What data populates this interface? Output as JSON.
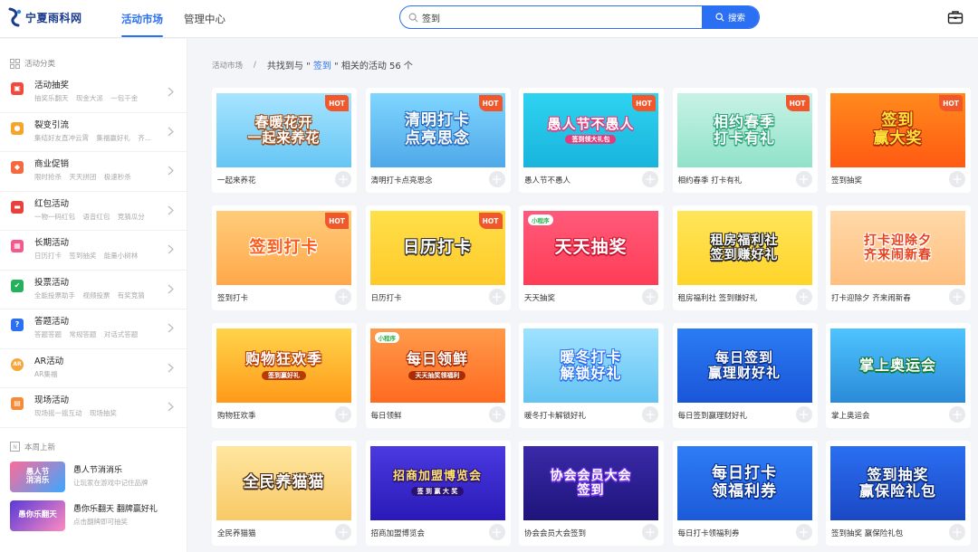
{
  "header": {
    "logo_text": "宁夏雨科网",
    "nav": [
      {
        "label": "活动市场",
        "active": true
      },
      {
        "label": "管理中心",
        "active": false
      }
    ],
    "search": {
      "value": "签到",
      "button": "搜索"
    }
  },
  "sidebar": {
    "section_title": "活动分类",
    "categories": [
      {
        "title": "活动抽奖",
        "sub": "抽奖乐翻天 现金大派 一包千金",
        "icon": "gift-icon",
        "color": "#f0493e"
      },
      {
        "title": "裂变引流",
        "sub": "集结好友直冲云霄 集福赢好礼 齐...",
        "icon": "user-icon",
        "color": "#f7a52a"
      },
      {
        "title": "商业促销",
        "sub": "限时抢杀 天天拼团 极速秒杀",
        "icon": "tag-icon",
        "color": "#f4693d"
      },
      {
        "title": "红包活动",
        "sub": "一物一码红包 语音红包 竞猜瓜分",
        "icon": "red-envelope-icon",
        "color": "#e8403a"
      },
      {
        "title": "长期活动",
        "sub": "日历打卡 签到抽奖 能量小树林",
        "icon": "calendar-icon",
        "color": "#f25a8f"
      },
      {
        "title": "投票活动",
        "sub": "全能投票助手 视频投票 有奖竞猜",
        "icon": "vote-icon",
        "color": "#23b15c"
      },
      {
        "title": "答题活动",
        "sub": "答题答题 常规答题 对话式答题",
        "icon": "question-icon",
        "color": "#2b6ff2"
      },
      {
        "title": "AR活动",
        "sub": "AR集福",
        "icon": "ar-icon",
        "color": "#f6a63a"
      },
      {
        "title": "现场活动",
        "sub": "现场摇一摇互动 现场抽奖",
        "icon": "live-icon",
        "color": "#f58a37"
      }
    ],
    "new_title": "本周上新",
    "new_items": [
      {
        "title": "愚人节消消乐",
        "sub": "让玩家在游戏中记住品牌",
        "thumb": "愚人节\n消消乐"
      },
      {
        "title": "愚你乐翻天 翻牌赢好礼",
        "sub": "点击翻牌即可抽奖",
        "thumb": "愚你乐翻天"
      }
    ]
  },
  "breadcrumb": {
    "root": "活动市场",
    "sep": "/",
    "pre": "共找到与 \" ",
    "keyword": "签到",
    "post": " \" 相关的活动 56 个"
  },
  "cards": [
    {
      "name": "一起来养花",
      "banner": "春暖花开\n一起来养花",
      "hot": true,
      "bg": "linear-gradient(180deg,#a7e4ff,#66c6f4)",
      "fg": "#fff",
      "stroke": "#9c4a17",
      "size": 15
    },
    {
      "name": "清明打卡点亮思念",
      "banner": "清明打卡\n点亮思念",
      "hot": true,
      "bg": "linear-gradient(180deg,#7fd6ff,#4fa8e8)",
      "fg": "#fff",
      "stroke": "#2d6cc0",
      "size": 17
    },
    {
      "name": "愚人节不愚人",
      "banner": "愚人节不愚人",
      "sub": "签到领大礼包",
      "hot": true,
      "bg": "linear-gradient(180deg,#2fd3f0,#18b4dc)",
      "fg": "#fff",
      "stroke": "#e23a7b",
      "size": 15
    },
    {
      "name": "相约春季 打卡有礼",
      "banner": "相约春季\n打卡有礼",
      "hot": true,
      "bg": "linear-gradient(180deg,#c8f2e6,#90e2c8)",
      "fg": "#fff",
      "stroke": "#2aa579",
      "size": 16
    },
    {
      "name": "签到抽奖",
      "banner": "签到\n赢大奖",
      "hot": true,
      "bg": "linear-gradient(180deg,#ff8a1d,#ff5a12)",
      "fg": "#ffe23a",
      "stroke": "#a42a05",
      "size": 17
    },
    {
      "name": "签到打卡",
      "banner": "签到打卡",
      "hot": true,
      "bg": "linear-gradient(180deg,#ffcc7a,#ffa84a)",
      "fg": "#ff5a16",
      "stroke": "#fff",
      "size": 18
    },
    {
      "name": "日历打卡",
      "banner": "日历打卡",
      "hot": true,
      "bg": "linear-gradient(180deg,#ffe04a,#ffc92a)",
      "fg": "#fff",
      "stroke": "#2a2a2a",
      "size": 18
    },
    {
      "name": "天天抽奖",
      "banner": "天天抽奖",
      "mini": "小程序",
      "bg": "linear-gradient(180deg,#ff5a7a,#ff3d56)",
      "fg": "#fff",
      "stroke": "#c8102d",
      "size": 19
    },
    {
      "name": "租房福利社 签到赚好礼",
      "banner": "租房福利社\n签到赚好礼",
      "bg": "linear-gradient(180deg,#ffe55a,#ffd42a)",
      "fg": "#fff",
      "stroke": "#1a1a1a",
      "size": 14
    },
    {
      "name": "打卡迎除夕 齐来闹新春",
      "banner": "打卡迎除夕\n齐来闹新春",
      "bg": "linear-gradient(180deg,#ffd9a8,#ffbf80)",
      "fg": "#e8411e",
      "stroke": "#fff",
      "size": 14
    },
    {
      "name": "购物狂欢季",
      "banner": "购物狂欢季",
      "sub": "签到赢好礼",
      "bg": "linear-gradient(180deg,#ffd44a,#ff9a1a)",
      "fg": "#fff",
      "stroke": "#b73b06",
      "size": 16
    },
    {
      "name": "每日领鲜",
      "banner": "每日领鲜",
      "sub": "天天抽奖领福利",
      "mini": "小程序",
      "bg": "linear-gradient(180deg,#ff9a4a,#ff6a20)",
      "fg": "#fff",
      "stroke": "#a82d04",
      "size": 16
    },
    {
      "name": "暖冬打卡解锁好礼",
      "banner": "暖冬打卡\n解锁好礼",
      "bg": "linear-gradient(180deg,#9fe2ff,#63c3f2)",
      "fg": "#fff",
      "stroke": "#2b6ff2",
      "size": 16
    },
    {
      "name": "每日签到赢理财好礼",
      "banner": "每日签到\n赢理财好礼",
      "bg": "linear-gradient(180deg,#2b7cf4,#1a55d8)",
      "fg": "#fff",
      "stroke": "#0a2f8c",
      "size": 15
    },
    {
      "name": "掌上奥运会",
      "banner": "掌上奥运会",
      "bg": "linear-gradient(180deg,#4ec4ff,#2a8ad8)",
      "fg": "#fff",
      "stroke": "#0e7a36",
      "size": 16
    },
    {
      "name": "全民养猫猫",
      "banner": "全民养猫猫",
      "bg": "linear-gradient(180deg,#ffe6a0,#f8c966)",
      "fg": "#fff",
      "stroke": "#4a2a10",
      "size": 17
    },
    {
      "name": "招商加盟博览会",
      "banner": "招商加盟博览会",
      "sub": "签 到 赢 大 奖",
      "bg": "linear-gradient(180deg,#4a3ae0,#2a1ab8)",
      "fg": "#ffe36a",
      "stroke": "#2a1070",
      "size": 13
    },
    {
      "name": "协会会员大会签到",
      "banner": "协会会员大会\n签到",
      "bg": "linear-gradient(180deg,#3a2aa8,#1e147a)",
      "fg": "#fff",
      "stroke": "#7a3af0",
      "size": 14
    },
    {
      "name": "每日打卡领福利券",
      "banner": "每日打卡\n领福利券",
      "bg": "linear-gradient(180deg,#2e7cf6,#1c5ad8)",
      "fg": "#fff",
      "stroke": "#0a2f8c",
      "size": 17
    },
    {
      "name": "签到抽奖 赢保险礼包",
      "banner": "签到抽奖\n赢保险礼包",
      "bg": "linear-gradient(180deg,#2b6ff2,#1a48c4)",
      "fg": "#fff",
      "stroke": "#0a2a7a",
      "size": 16
    }
  ]
}
